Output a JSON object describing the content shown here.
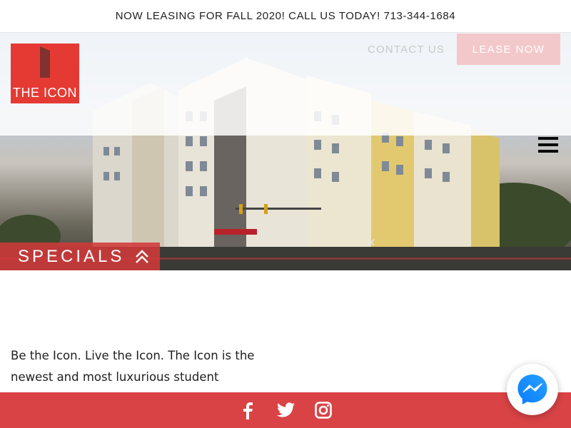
{
  "announcement": {
    "text": "NOW LEASING FOR FALL 2020! CALL US TODAY! 713-344-1684"
  },
  "brand": {
    "logo_text": "THE ICON",
    "accent": "#e53a33"
  },
  "nav": {
    "contact_label": "CONTACT US",
    "lease_label": "LEASE NOW",
    "menu_icon": "hamburger-icon"
  },
  "hero": {
    "specials_label": "SPECIALS",
    "specials_icon": "double-chevron-up-icon",
    "close_icon": "close-icon"
  },
  "content": {
    "intro": "Be the Icon. Live the Icon. The Icon is the newest and most luxurious student housing"
  },
  "footer": {
    "color": "#d94346",
    "social": [
      "facebook-icon",
      "twitter-icon",
      "instagram-icon"
    ]
  },
  "chat": {
    "icon": "messenger-icon"
  }
}
